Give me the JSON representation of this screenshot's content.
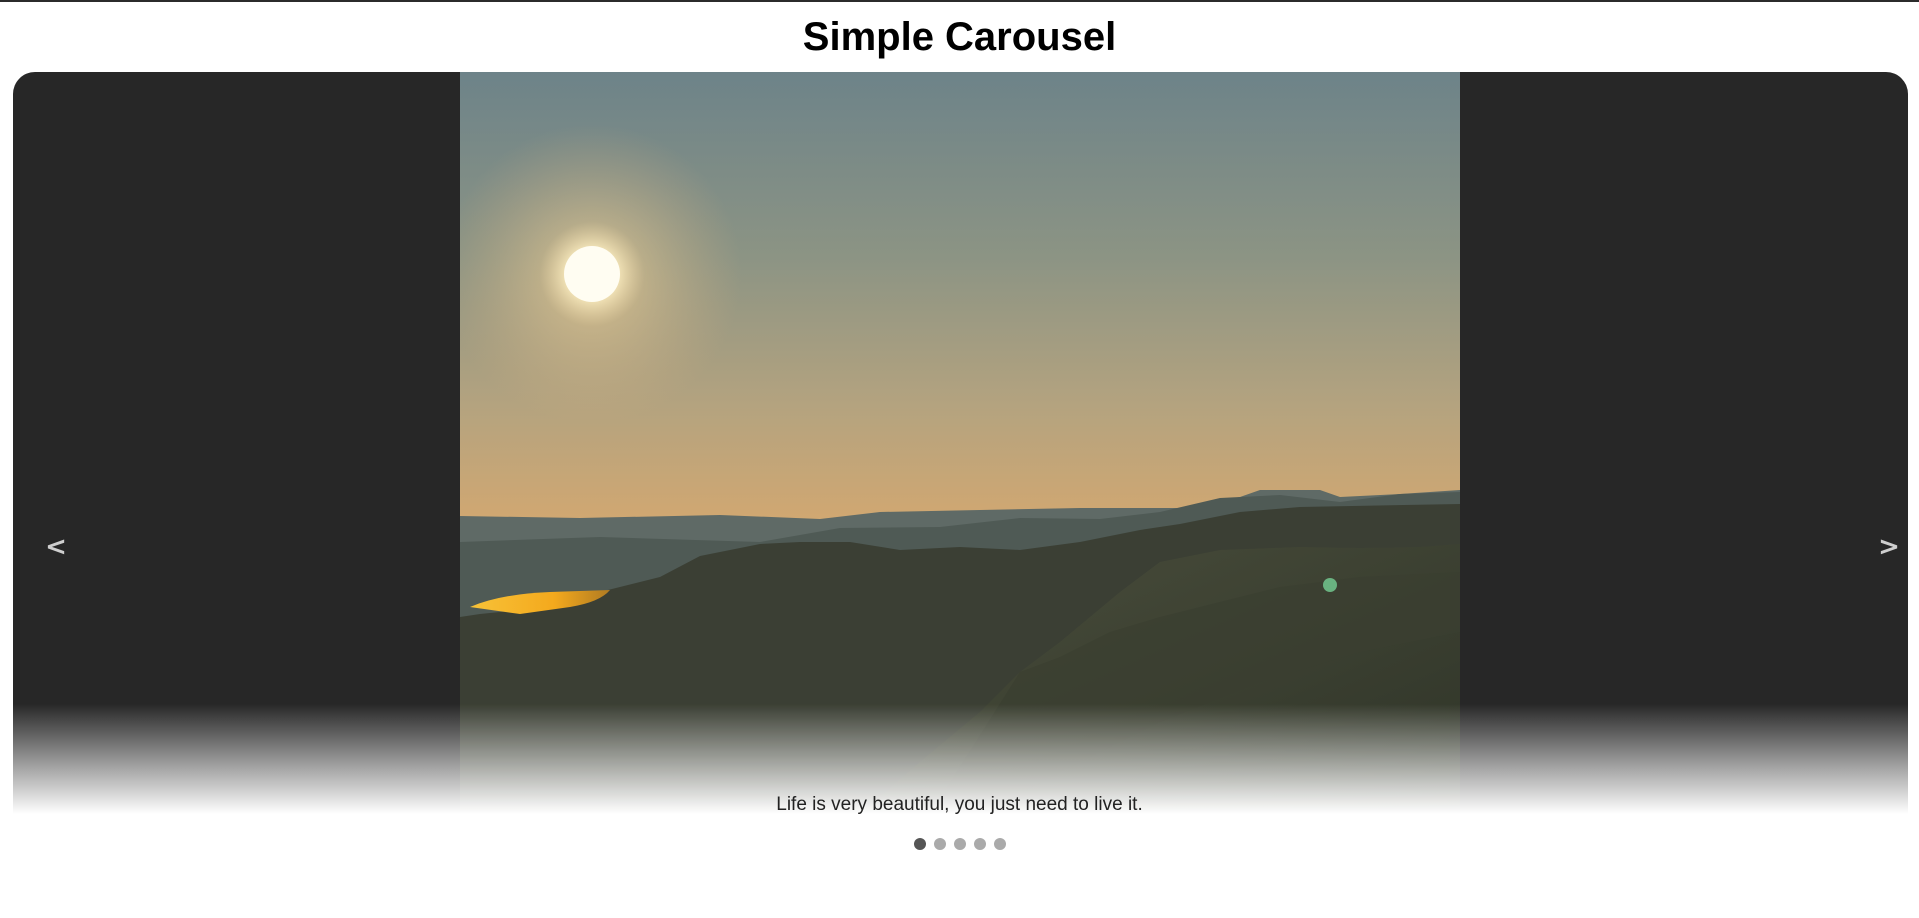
{
  "page": {
    "title": "Simple Carousel"
  },
  "carousel": {
    "prev_label": "<",
    "next_label": ">",
    "current_index": 1,
    "slide_count": 5,
    "slides": [
      {
        "caption": "Life is very beautiful, you just need to live it.",
        "image": "sunset-over-mountain-valley"
      }
    ],
    "dots": [
      {
        "active": true
      },
      {
        "active": false
      },
      {
        "active": false
      },
      {
        "active": false
      },
      {
        "active": false
      }
    ]
  },
  "colors": {
    "carousel_background": "#272727",
    "arrow": "#cfcfcf",
    "dot_active": "#555555",
    "dot_inactive": "#aaaaaa"
  }
}
